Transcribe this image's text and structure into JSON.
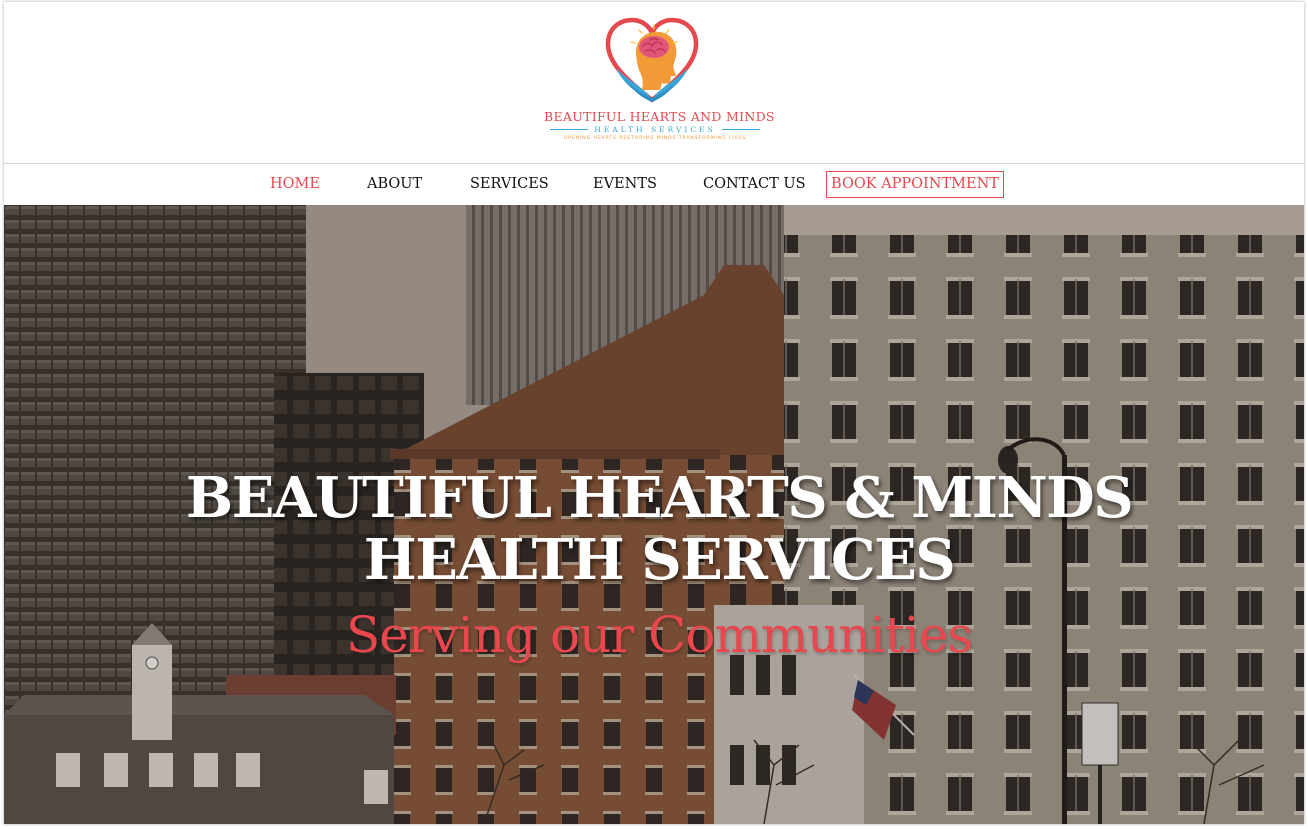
{
  "logo": {
    "name": "BEAUTIFUL HEARTS AND MINDS",
    "subname": "HEALTH SERVICES",
    "tagline": "OPENING HEARTS RESTORING MINDS TRANSFORMING LIVES"
  },
  "nav": {
    "items": [
      {
        "label": "HOME",
        "active": true
      },
      {
        "label": "ABOUT",
        "active": false
      },
      {
        "label": "SERVICES",
        "active": false
      },
      {
        "label": "EVENTS",
        "active": false
      },
      {
        "label": "CONTACT US",
        "active": false
      }
    ],
    "cta_label": "BOOK APPOINTMENT"
  },
  "hero": {
    "title_line1": "BEAUTIFUL HEARTS & MINDS",
    "title_line2": "HEALTH SERVICES",
    "subtitle": "Serving our Communities"
  },
  "colors": {
    "accent": "#e5484d",
    "logo_blue": "#3aa6d8",
    "logo_orange": "#f29a38",
    "text": "#111111",
    "hero_title": "#ffffff"
  },
  "icons": {
    "logo_mark": "heart-head-hands-logo-icon"
  }
}
